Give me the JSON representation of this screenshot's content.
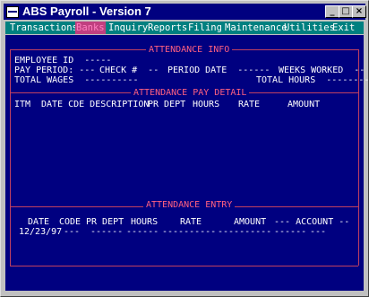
{
  "window": {
    "title": "ABS Payroll - Version 7",
    "minimize": "_",
    "maximize": "□",
    "close": "×"
  },
  "menu": [
    "Transactions",
    "Banks",
    "Inquiry",
    "Reports",
    "Filing",
    "Maintenance",
    "Utilities",
    "Exit"
  ],
  "attendance_info": {
    "title": "ATTENDANCE INFO",
    "employee_id": "EMPLOYEE ID  -----",
    "pay_period": "PAY PERIOD: ---",
    "check": "CHECK #  --",
    "period_date": "PERIOD DATE  ------",
    "weeks_worked": "WEEKS WORKED  --",
    "total_wages": "TOTAL WAGES  ----------",
    "total_hours": "TOTAL HOURS  --------"
  },
  "pay_detail": {
    "title": "ATTENDANCE PAY DETAIL",
    "headers": {
      "itm": "ITM",
      "date_code": "DATE CDE DESCRIPTION",
      "pr_dept": "PR DEPT",
      "hours": "HOURS",
      "rate": "RATE",
      "amount": "AMOUNT"
    }
  },
  "entry": {
    "title": "ATTENDANCE ENTRY",
    "headers": {
      "date": "DATE",
      "code": "CODE",
      "pr_dept": "PR DEPT",
      "hours": "HOURS",
      "rate": "RATE",
      "amount": "AMOUNT",
      "account": "--- ACCOUNT --"
    },
    "values": {
      "date": "12/23/97",
      "code": "---",
      "pr_dept": "------",
      "hours": "------",
      "rate": "----------",
      "amount": "----------",
      "account_a": "------",
      "account_b": "---"
    }
  }
}
